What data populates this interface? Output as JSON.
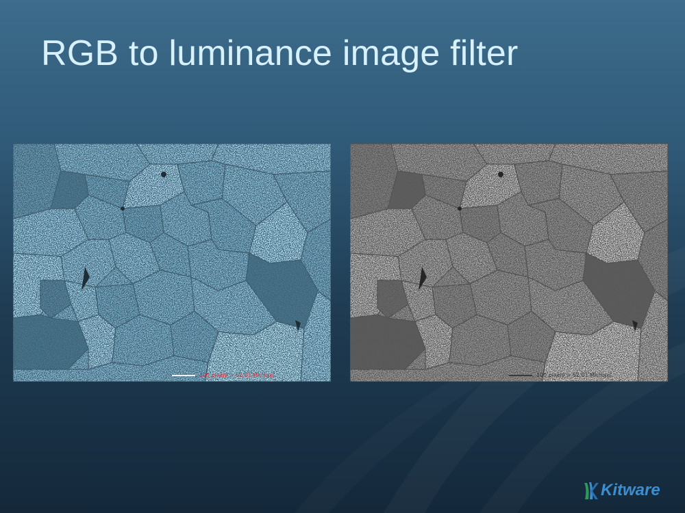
{
  "slide": {
    "title": "RGB to luminance image filter"
  },
  "images": {
    "input": {
      "scale_label": "100 pixels = 52.01 Microns",
      "label_color": "#e0303a"
    },
    "output": {
      "scale_label": "100 pixels = 52.01 Microns",
      "label_color": "#3a3a3a"
    }
  },
  "branding": {
    "logo_text": "Kitware",
    "logo_color": "#3b8fd0",
    "logo_icon": "kitware-logo-icon"
  },
  "colors": {
    "title": "#d7f1ff",
    "background_top": "#3d6c8c",
    "background_bottom": "#14283a"
  }
}
